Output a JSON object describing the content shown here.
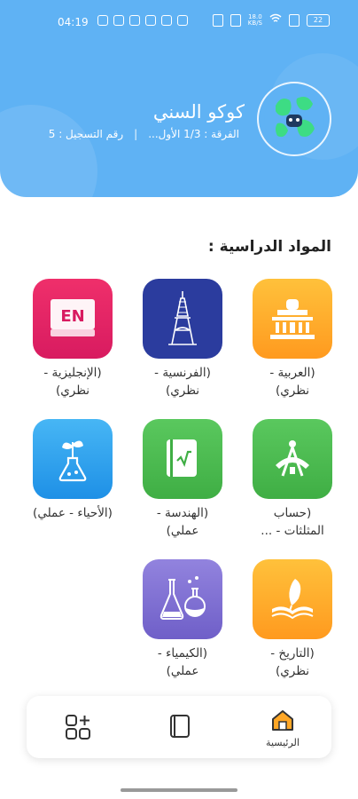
{
  "status_bar": {
    "time": "04:19",
    "network": "18.0\nKB/S",
    "battery": "22"
  },
  "profile": {
    "name": "كوكو السني",
    "grade": "الفرقة : 1/3 الأول...",
    "separator": "|",
    "registration": "رقم التسجيل : 5"
  },
  "section_title": "المواد الدراسية :",
  "subjects": [
    {
      "label": "(العربية - نظري)",
      "icon": "capitol-building-icon",
      "color": "#ffa726"
    },
    {
      "label": "(الفرنسية - نظري)",
      "icon": "eiffel-tower-icon",
      "color": "#2b3c9e"
    },
    {
      "label": "(الإنجليزية - نظري)",
      "icon": "english-book-icon",
      "color": "#e91e63"
    },
    {
      "label": "(حساب المثلثات - ...",
      "icon": "compass-ruler-icon",
      "color": "#4caf50"
    },
    {
      "label": "(الهندسة - عملي)",
      "icon": "geometry-book-icon",
      "color": "#43a047"
    },
    {
      "label": "(الأحياء - عملي)",
      "icon": "plant-flask-icon",
      "color": "#1e9be9"
    },
    {
      "label": "(التاريخ - نظري)",
      "icon": "quill-book-icon",
      "color": "#ffa000"
    },
    {
      "label": "(الكيمياء - عملي)",
      "icon": "chemistry-flasks-icon",
      "color": "#7e6fd0"
    }
  ],
  "bottom_nav": {
    "home_label": "الرئيسية",
    "home_icon": "home-icon",
    "book_icon": "book-icon",
    "apps_icon": "apps-icon"
  }
}
